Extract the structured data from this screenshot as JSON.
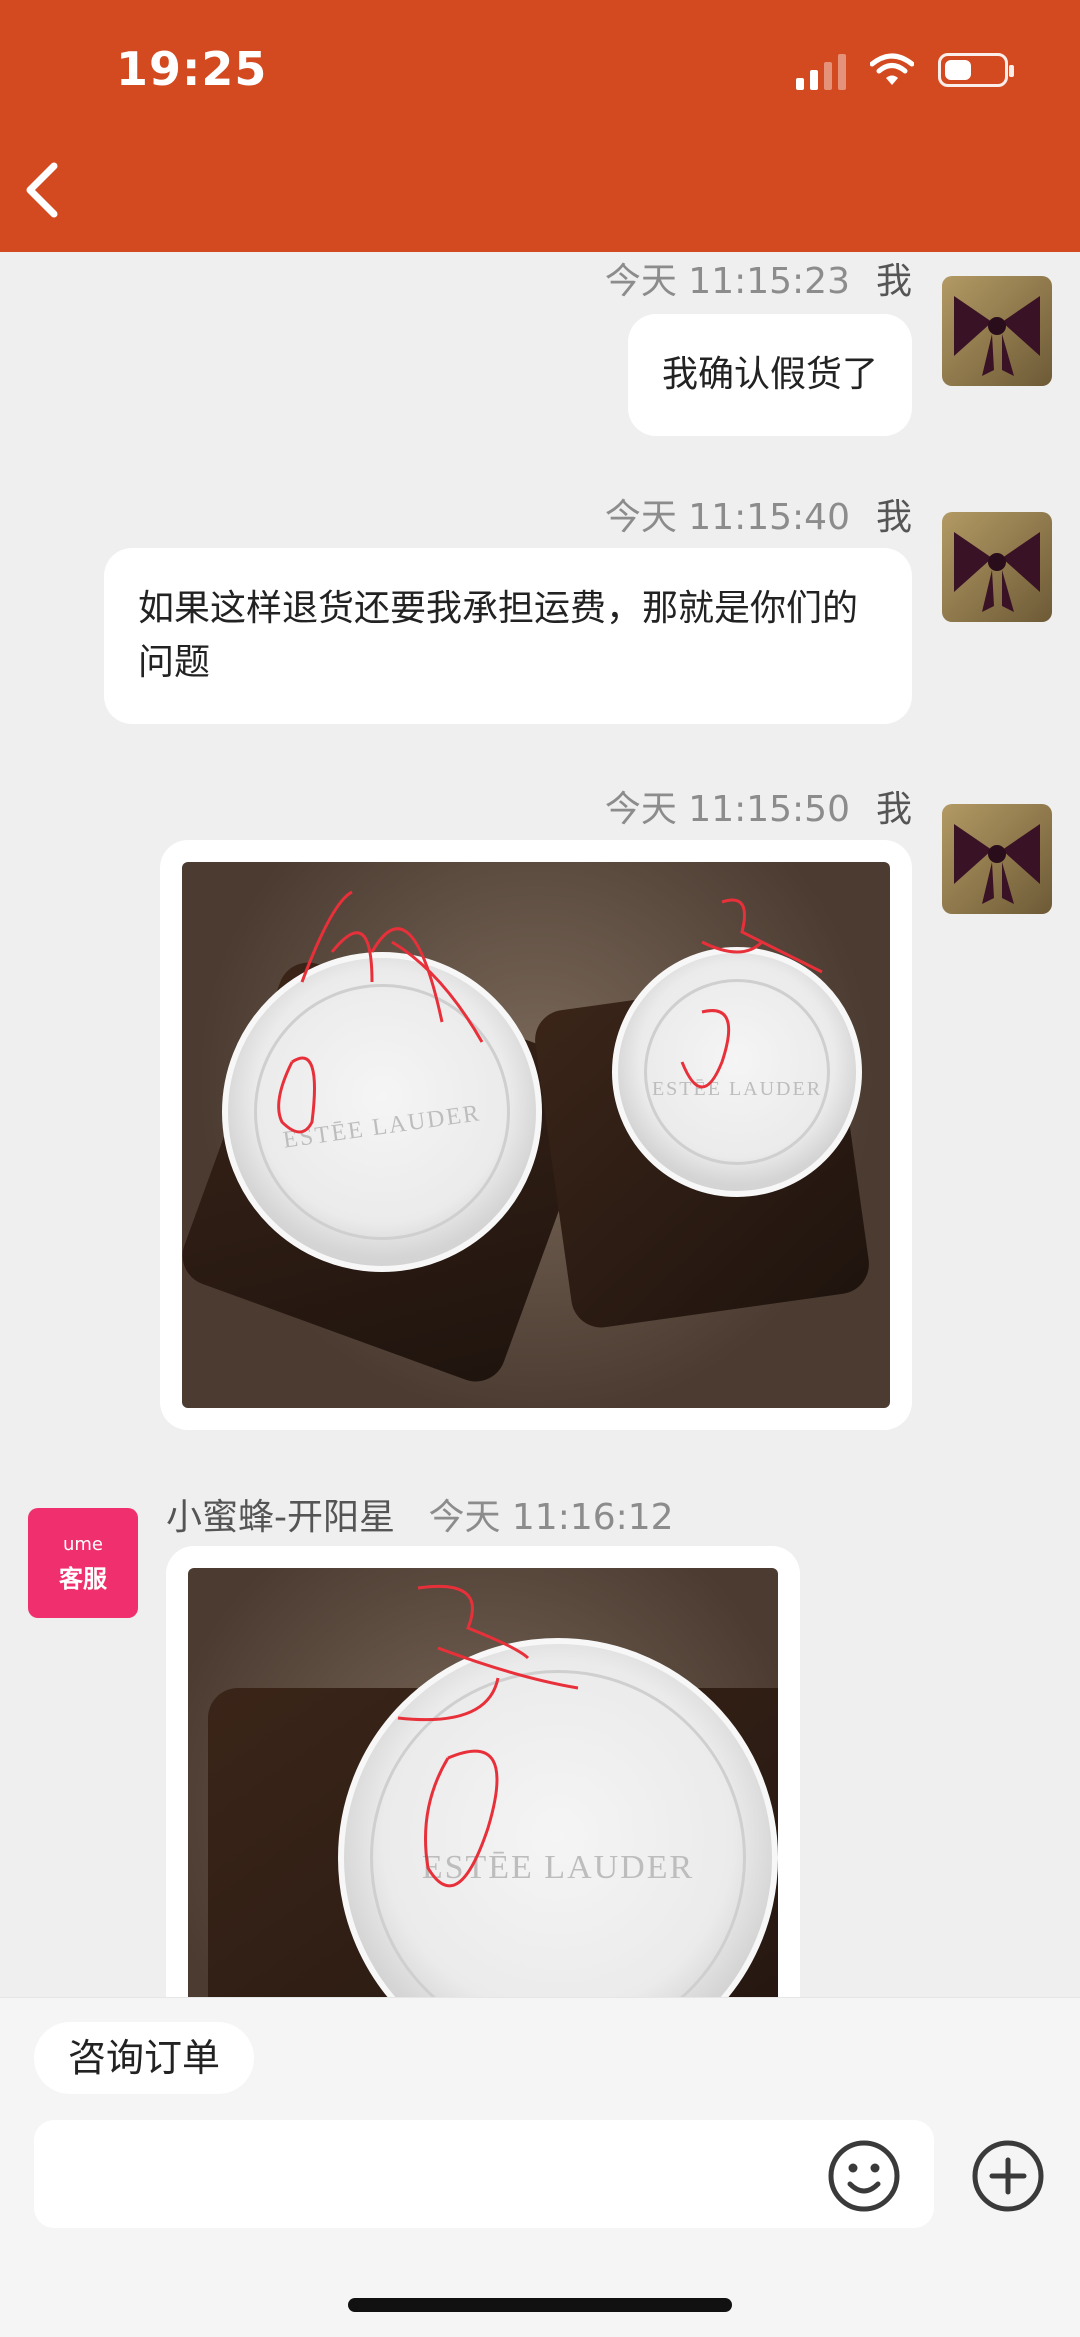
{
  "status_bar": {
    "time": "19:25"
  },
  "messages": [
    {
      "time": "今天 11:15:23",
      "sender": "我",
      "text": "我确认假货了"
    },
    {
      "time": "今天 11:15:40",
      "sender": "我",
      "text": "如果这样退货还要我承担运费，那就是你们的问题"
    },
    {
      "time": "今天 11:15:50",
      "sender": "我",
      "image_brand": "ESTĒE LAUDER"
    },
    {
      "agent_name": "小蜜蜂-开阳星",
      "time": "今天 11:16:12",
      "image_brand": "ESTĒE LAUDER"
    }
  ],
  "agent_avatar": {
    "line1": "ume",
    "line2": "客服"
  },
  "bottom": {
    "quick_chip": "咨询订单"
  },
  "icons": {
    "back": "back-arrow-icon",
    "emoji": "emoji-icon",
    "plus": "plus-icon",
    "signal": "signal-icon",
    "wifi": "wifi-icon",
    "battery": "battery-icon"
  },
  "colors": {
    "header": "#d34a21",
    "agent_avatar": "#f0306e",
    "page_bg": "#efefef"
  }
}
